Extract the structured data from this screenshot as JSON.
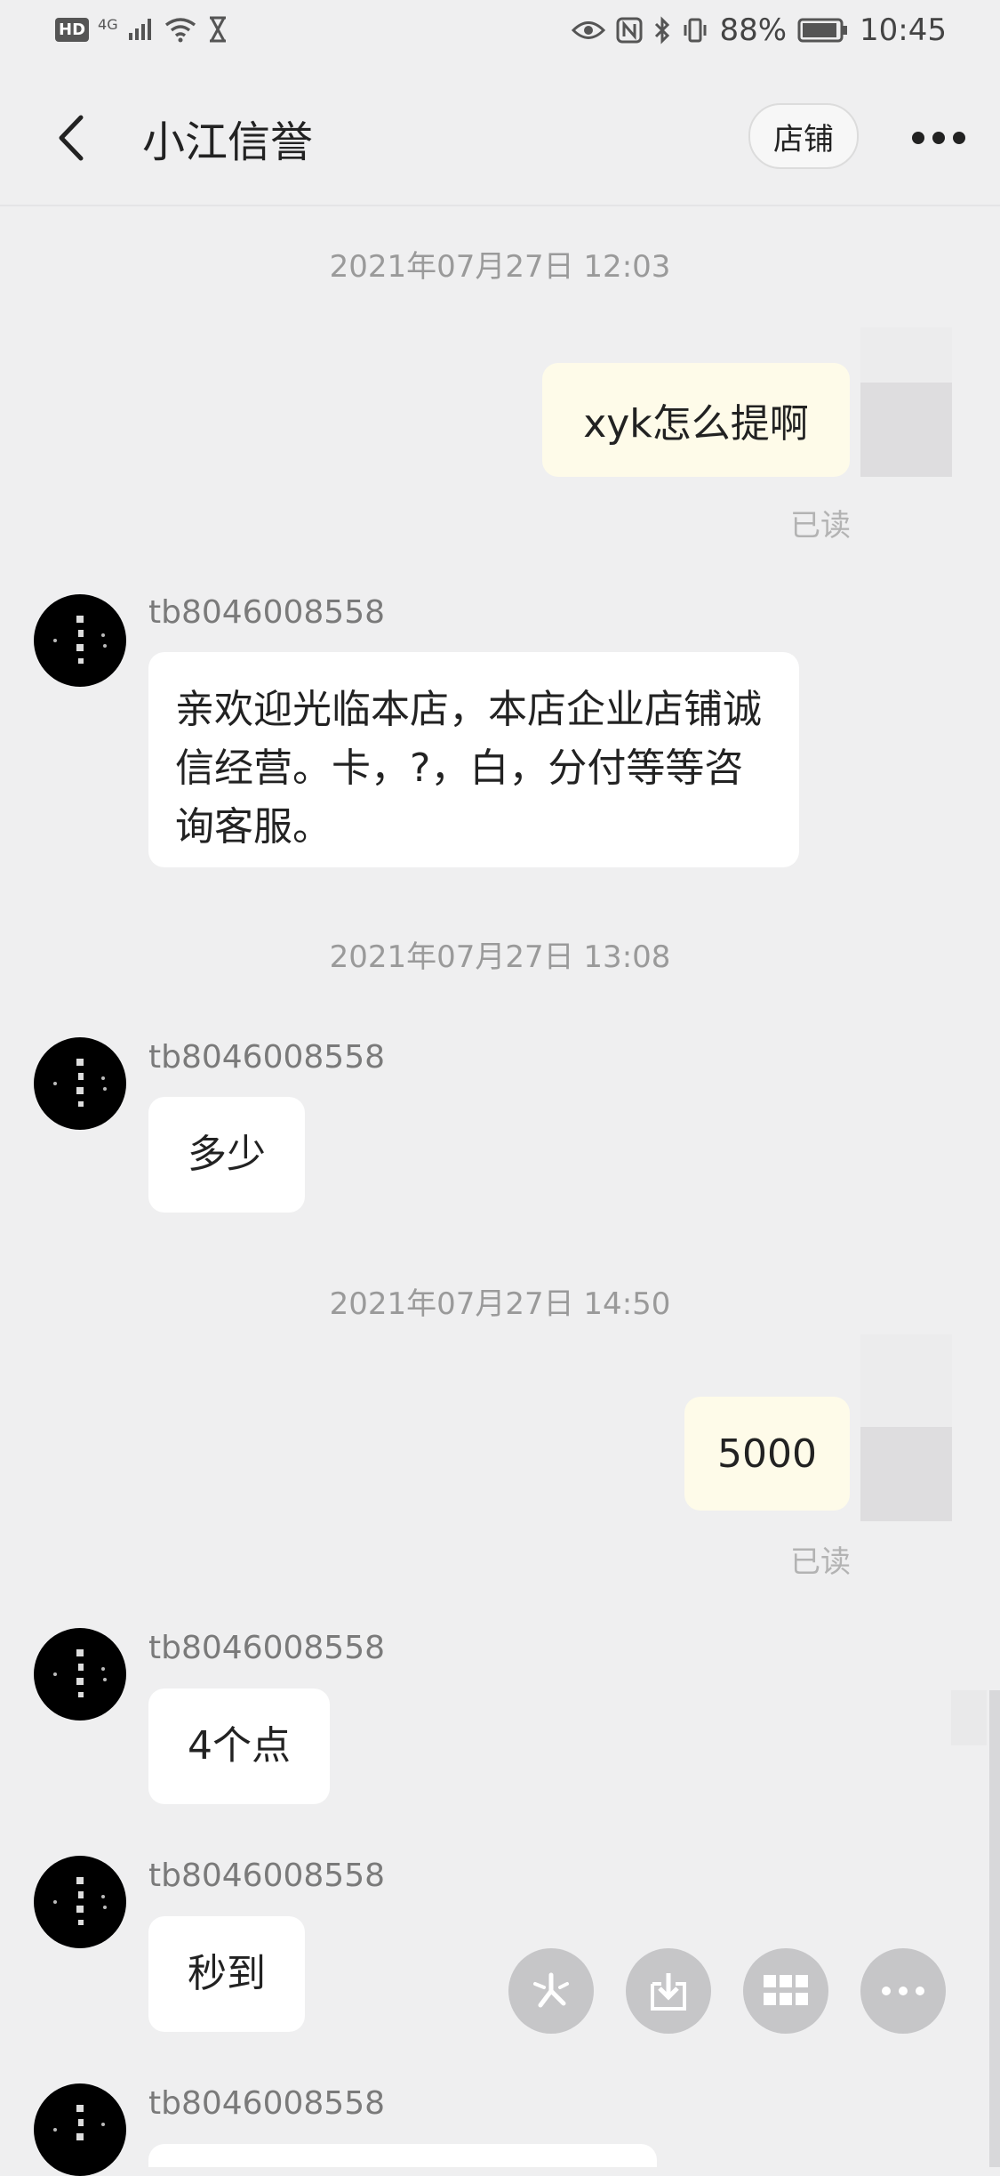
{
  "status_bar": {
    "hd_badge": "HD",
    "network": "4G",
    "battery": "88%",
    "time": "10:45",
    "icons": [
      "signal-icon",
      "wifi-icon",
      "hourglass-icon",
      "eye-icon",
      "nfc-icon",
      "bluetooth-icon",
      "vibrate-icon",
      "battery-icon"
    ]
  },
  "nav": {
    "title": "小江信誉",
    "shop_label": "店铺",
    "icons": [
      "back-arrow-icon",
      "more-dots-icon"
    ]
  },
  "chat": {
    "timestamps": [
      "2021年07月27日 12:03",
      "2021年07月27日 13:08",
      "2021年07月27日 14:50"
    ],
    "read_label": "已读",
    "sender": "tb8046008558",
    "outgoing": [
      "xyk怎么提啊",
      "5000"
    ],
    "incoming": [
      "亲欢迎光临本店，本店企业店铺诚信经营。卡，?，白，分付等等咨询客服。",
      "多少",
      "4个点",
      "秒到"
    ]
  },
  "toolbar": {
    "icons": [
      "sparkle-icon",
      "download-icon",
      "grid-icon",
      "more-icon"
    ]
  },
  "colors": {
    "background": "#efeff0",
    "bubble_incoming": "#ffffff",
    "bubble_outgoing": "#fefbe9",
    "fab": "#c6c6c8",
    "muted_text": "#9a9a9a"
  }
}
